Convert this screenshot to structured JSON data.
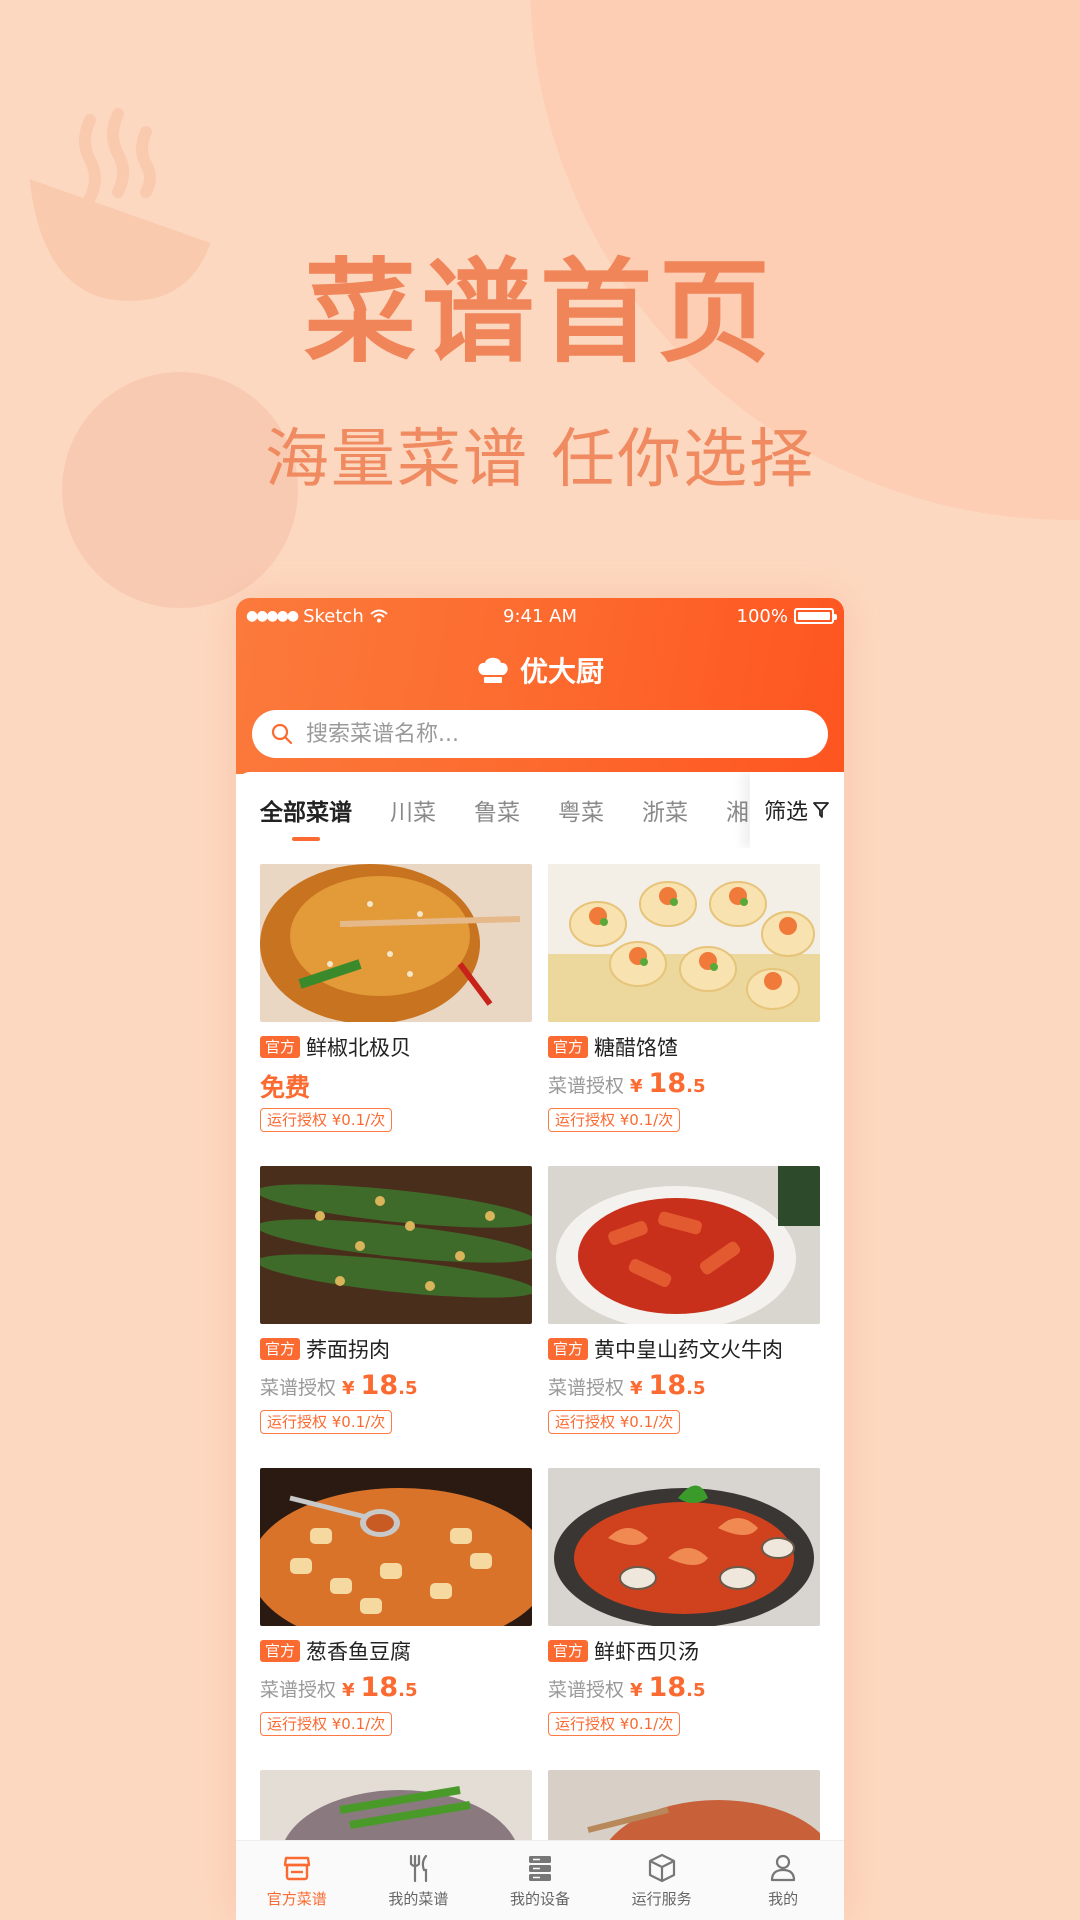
{
  "promo": {
    "headline": "菜谱首页",
    "subline": "海量菜谱 任你选择"
  },
  "status_bar": {
    "carrier": "Sketch",
    "time": "9:41 AM",
    "battery": "100%"
  },
  "header": {
    "title": "优大厨",
    "search_placeholder": "搜索菜谱名称..."
  },
  "tabs": {
    "items": [
      "全部菜谱",
      "川菜",
      "鲁菜",
      "粤菜",
      "浙菜",
      "湘菜"
    ],
    "active_index": 0,
    "filter_label": "筛选"
  },
  "recipes": [
    {
      "badge": "官方",
      "name": "鲜椒北极贝",
      "free": true,
      "free_label": "免费",
      "run_tag": "运行授权 ¥0.1/次",
      "image": "fried-patty-with-sesame"
    },
    {
      "badge": "官方",
      "name": "糖醋饹馇",
      "free": false,
      "price_label": "菜谱授权",
      "currency": "¥",
      "price_int": "18",
      "price_dec": ".5",
      "run_tag": "运行授权 ¥0.1/次",
      "image": "shrimp-tofu-cups"
    },
    {
      "badge": "官方",
      "name": "荞面拐肉",
      "free": false,
      "price_label": "菜谱授权",
      "currency": "¥",
      "price_int": "18",
      "price_dec": ".5",
      "run_tag": "运行授权 ¥0.1/次",
      "image": "okra-with-garlic"
    },
    {
      "badge": "官方",
      "name": "黄中皇山药文火牛肉",
      "free": false,
      "price_label": "菜谱授权",
      "currency": "¥",
      "price_int": "18",
      "price_dec": ".5",
      "run_tag": "运行授权 ¥0.1/次",
      "image": "spicy-rice-cakes"
    },
    {
      "badge": "官方",
      "name": "葱香鱼豆腐",
      "free": false,
      "price_label": "菜谱授权",
      "currency": "¥",
      "price_int": "18",
      "price_dec": ".5",
      "run_tag": "运行授权 ¥0.1/次",
      "image": "tofu-in-sauce"
    },
    {
      "badge": "官方",
      "name": "鲜虾西贝汤",
      "free": false,
      "price_label": "菜谱授权",
      "currency": "¥",
      "price_int": "18",
      "price_dec": ".5",
      "run_tag": "运行授权 ¥0.1/次",
      "image": "shrimp-clam-stew"
    }
  ],
  "tabbar": {
    "items": [
      {
        "label": "官方菜谱",
        "icon": "store-icon",
        "active": true
      },
      {
        "label": "我的菜谱",
        "icon": "fork-knife-icon",
        "active": false
      },
      {
        "label": "我的设备",
        "icon": "server-icon",
        "active": false
      },
      {
        "label": "运行服务",
        "icon": "box-icon",
        "active": false
      },
      {
        "label": "我的",
        "icon": "user-icon",
        "active": false
      }
    ]
  },
  "colors": {
    "accent": "#fb6a30",
    "background": "#fdd8c0",
    "headline": "#f0855a"
  }
}
